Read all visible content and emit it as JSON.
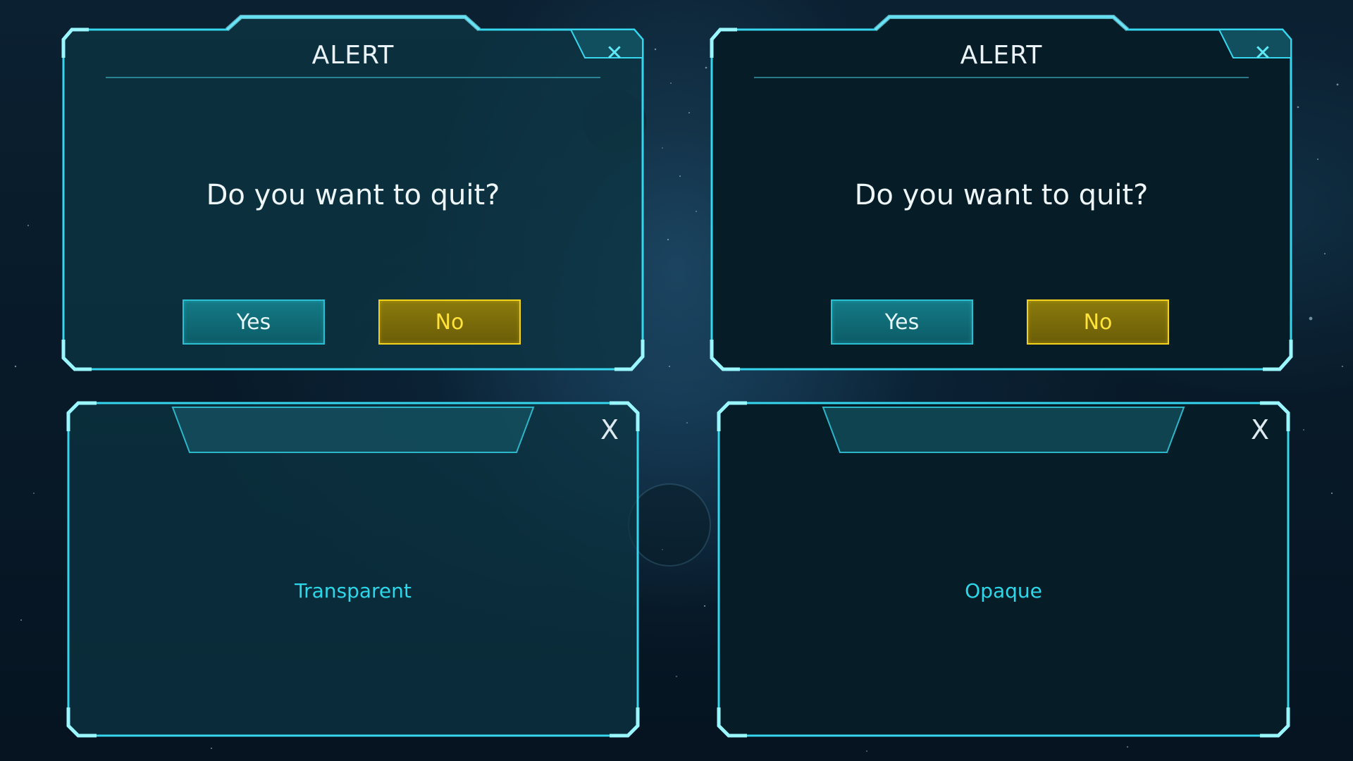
{
  "dialogs": [
    {
      "variant": "transparent",
      "title": "ALERT",
      "close_label": "✕",
      "question": "Do you want to quit?",
      "yes_label": "Yes",
      "no_label": "No"
    },
    {
      "variant": "opaque",
      "title": "ALERT",
      "close_label": "✕",
      "question": "Do you want to quit?",
      "yes_label": "Yes",
      "no_label": "No"
    }
  ],
  "windows": [
    {
      "label": "Transparent",
      "close_label": "X"
    },
    {
      "label": "Opaque",
      "close_label": "X"
    }
  ],
  "colors": {
    "frame_cyan": "#35d6ee",
    "panel_transparent": "#0d3442",
    "panel_opaque": "#061c26",
    "yes_button": "#0f6b76",
    "no_button": "#7a6c0a",
    "no_text": "#ffe33a",
    "label_cyan": "#2cd7ea"
  },
  "icons": {
    "dialog_close": "close-icon",
    "window_close": "close-icon"
  }
}
